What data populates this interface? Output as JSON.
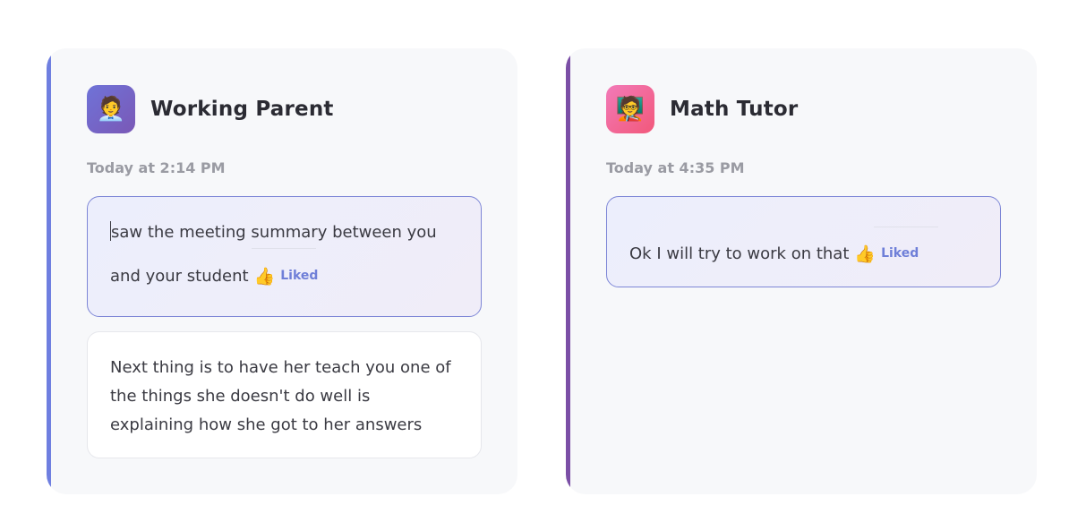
{
  "conversations": [
    {
      "name": "Working Parent",
      "avatar_icon": "person-in-suit-icon",
      "avatar_glyph": "🧑‍💼",
      "timestamp": "Today at 2:14 PM",
      "accent_color": "#6f7fe0",
      "messages": [
        {
          "line1": "saw the meeting summary between you",
          "line2": "and your student",
          "reaction": "Liked",
          "reaction_glyph": "👍"
        },
        {
          "text": "Next thing is to have her teach you one of the things she doesn't do well is explaining how she got to her answers"
        }
      ]
    },
    {
      "name": "Math Tutor",
      "avatar_icon": "teacher-at-chalkboard-icon",
      "avatar_glyph": "🧑‍🏫",
      "timestamp": "Today at 4:35 PM",
      "accent_color": "#7b4fa6",
      "messages": [
        {
          "text": "Ok I will try to work on that",
          "reaction": "Liked",
          "reaction_glyph": "👍"
        }
      ]
    }
  ]
}
